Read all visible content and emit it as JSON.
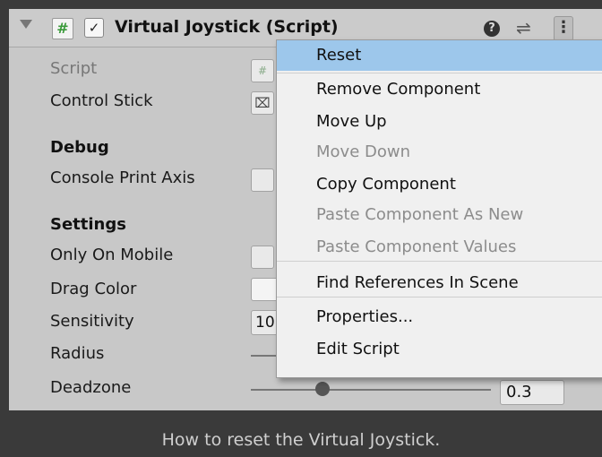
{
  "header": {
    "title": "Virtual Joystick (Script)",
    "script_icon": "#",
    "enabled_check": "✓",
    "help_icon": "?",
    "preset_icon": "⇌",
    "menu_icon": "⋮"
  },
  "fields": {
    "script_label": "Script",
    "script_icon_glyph": "#",
    "control_stick_label": "Control Stick",
    "control_stick_icon": "⌧",
    "debug_header": "Debug",
    "console_print_axis_label": "Console Print Axis",
    "settings_header": "Settings",
    "only_on_mobile_label": "Only On Mobile",
    "drag_color_label": "Drag Color",
    "sensitivity_label": "Sensitivity",
    "sensitivity_value": "10",
    "radius_label": "Radius",
    "deadzone_label": "Deadzone",
    "deadzone_value": "0.3",
    "deadzone_fraction": 0.3
  },
  "context_menu": {
    "items": [
      {
        "label": "Reset",
        "state": "selected"
      },
      {
        "label": "Remove Component",
        "state": "enabled"
      },
      {
        "label": "Move Up",
        "state": "enabled"
      },
      {
        "label": "Move Down",
        "state": "disabled"
      },
      {
        "label": "Copy Component",
        "state": "enabled"
      },
      {
        "label": "Paste Component As New",
        "state": "disabled"
      },
      {
        "label": "Paste Component Values",
        "state": "disabled"
      },
      {
        "label": "Find References In Scene",
        "state": "enabled"
      },
      {
        "label": "Properties...",
        "state": "enabled"
      },
      {
        "label": "Edit Script",
        "state": "enabled"
      }
    ]
  },
  "caption": "How to reset the Virtual Joystick.",
  "colors": {
    "selected_highlight": "#9dc7eb",
    "panel_bg": "#c8c8c8",
    "page_bg": "#3a3a3a"
  }
}
